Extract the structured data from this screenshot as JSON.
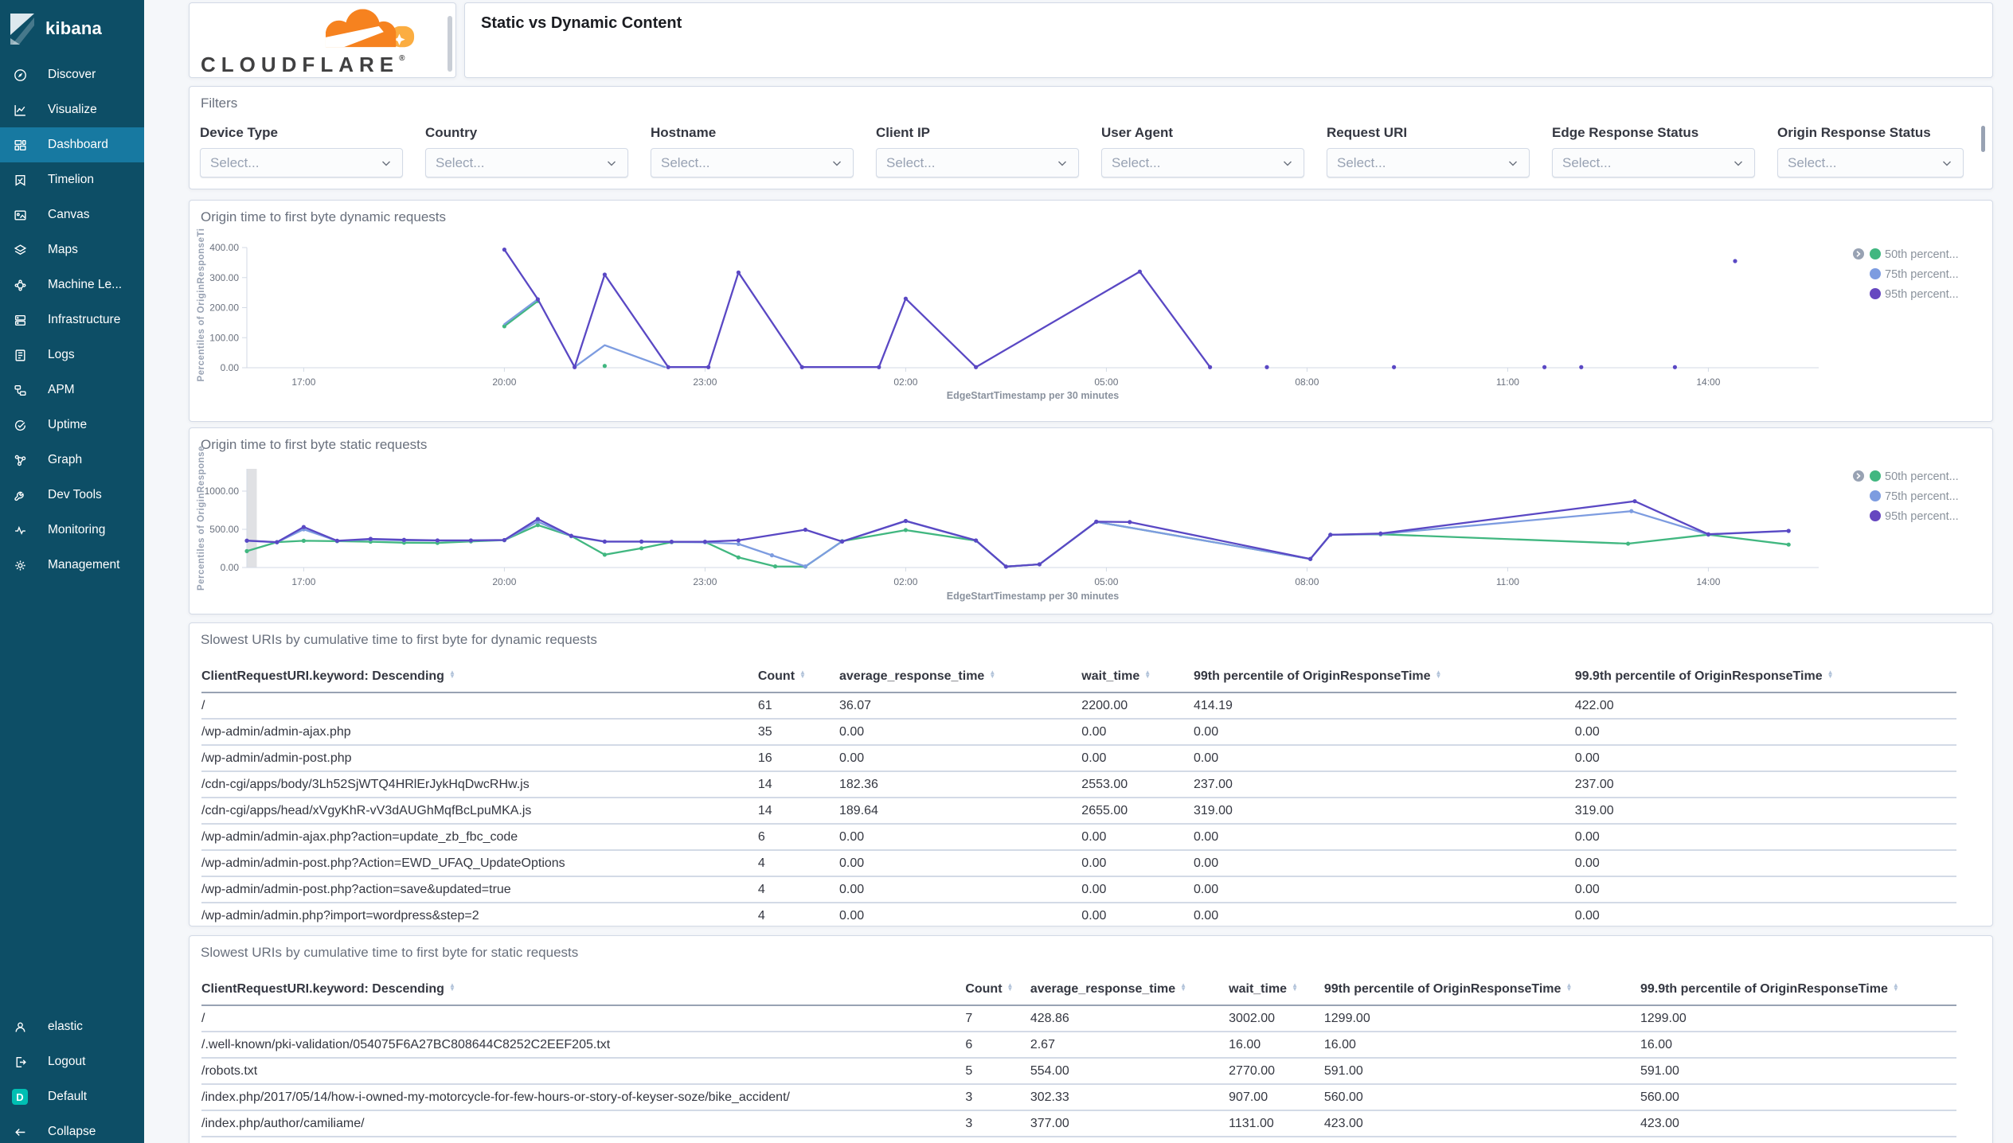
{
  "colors": {
    "sidebar_bg": "#0d4e66",
    "sidebar_selected": "#1779a1",
    "space_badge": "#00bfb3",
    "brand_orange": "#f6821f",
    "brand_orange_light": "#fbad41",
    "series_green": "#41b780",
    "series_blue": "#7d9ce0",
    "series_purple": "#5a48c4"
  },
  "sidebar": {
    "brand": "kibana",
    "items": [
      {
        "label": "Discover",
        "icon": "discover",
        "selected": false
      },
      {
        "label": "Visualize",
        "icon": "visualize",
        "selected": false
      },
      {
        "label": "Dashboard",
        "icon": "dashboard",
        "selected": true
      },
      {
        "label": "Timelion",
        "icon": "timelion",
        "selected": false
      },
      {
        "label": "Canvas",
        "icon": "canvas",
        "selected": false
      },
      {
        "label": "Maps",
        "icon": "maps",
        "selected": false
      },
      {
        "label": "Machine Le...",
        "icon": "machine-learning",
        "selected": false
      },
      {
        "label": "Infrastructure",
        "icon": "infrastructure",
        "selected": false
      },
      {
        "label": "Logs",
        "icon": "logs",
        "selected": false
      },
      {
        "label": "APM",
        "icon": "apm",
        "selected": false
      },
      {
        "label": "Uptime",
        "icon": "uptime",
        "selected": false
      },
      {
        "label": "Graph",
        "icon": "graph",
        "selected": false
      },
      {
        "label": "Dev Tools",
        "icon": "dev-tools",
        "selected": false
      },
      {
        "label": "Monitoring",
        "icon": "monitoring",
        "selected": false
      },
      {
        "label": "Management",
        "icon": "management",
        "selected": false
      }
    ],
    "bottom_items": [
      {
        "label": "elastic",
        "icon": "user"
      },
      {
        "label": "Logout",
        "icon": "logout"
      },
      {
        "label": "Default",
        "icon": "space-default",
        "badge": "D"
      },
      {
        "label": "Collapse",
        "icon": "collapse"
      }
    ]
  },
  "header": {
    "logo_text": "CLOUDFLARE",
    "logo_registered": "®",
    "title": "Static vs Dynamic Content"
  },
  "filters": {
    "panel_title": "Filters",
    "fields": [
      {
        "label": "Device Type",
        "placeholder": "Select..."
      },
      {
        "label": "Country",
        "placeholder": "Select..."
      },
      {
        "label": "Hostname",
        "placeholder": "Select..."
      },
      {
        "label": "Client IP",
        "placeholder": "Select..."
      },
      {
        "label": "User Agent",
        "placeholder": "Select..."
      },
      {
        "label": "Request URI",
        "placeholder": "Select..."
      },
      {
        "label": "Edge Response Status",
        "placeholder": "Select..."
      },
      {
        "label": "Origin Response Status",
        "placeholder": "Select..."
      }
    ]
  },
  "chart_data": [
    {
      "type": "line",
      "title": "Origin time to first byte dynamic requests",
      "xlabel": "EdgeStartTimestamp per 30 minutes",
      "ylabel": "Percentiles of OriginResponseTi",
      "ylim": [
        0,
        400
      ],
      "yticks": [
        {
          "v": 0,
          "label": "0.00"
        },
        {
          "v": 100,
          "label": "100.00"
        },
        {
          "v": 200,
          "label": "200.00"
        },
        {
          "v": 300,
          "label": "300.00"
        },
        {
          "v": 400,
          "label": "400.00"
        }
      ],
      "xticks": [
        {
          "t": 17,
          "label": "17:00"
        },
        {
          "t": 20,
          "label": "20:00"
        },
        {
          "t": 23,
          "label": "23:00"
        },
        {
          "t": 26,
          "label": "02:00"
        },
        {
          "t": 29,
          "label": "05:00"
        },
        {
          "t": 32,
          "label": "08:00"
        },
        {
          "t": 35,
          "label": "11:00"
        },
        {
          "t": 38,
          "label": "14:00"
        }
      ],
      "legend": [
        {
          "name": "50th percent...",
          "color": "#41b780"
        },
        {
          "name": "75th percent...",
          "color": "#7d9ce0"
        },
        {
          "name": "95th percent...",
          "color": "#6647c0"
        }
      ],
      "series": [
        {
          "name": "50th percent...",
          "color": "#41b780",
          "markers": true,
          "segments": [
            [
              [
                20,
                138
              ],
              [
                20.5,
                222
              ]
            ]
          ],
          "points": [
            [
              21.5,
              6
            ]
          ]
        },
        {
          "name": "75th percent...",
          "color": "#7d9ce0",
          "markers": false,
          "segments": [
            [
              [
                20,
                145
              ],
              [
                20.5,
                228
              ]
            ],
            [
              [
                21.05,
                2
              ],
              [
                21.5,
                75
              ],
              [
                22.4,
                2
              ]
            ]
          ],
          "points": []
        },
        {
          "name": "95th percent...",
          "color": "#5a48c4",
          "markers": true,
          "segments": [
            [
              [
                20,
                393
              ],
              [
                20.5,
                228
              ],
              [
                21.05,
                2
              ],
              [
                21.5,
                310
              ],
              [
                22.45,
                2
              ],
              [
                23.05,
                2
              ],
              [
                23.5,
                317
              ],
              [
                24.45,
                2
              ],
              [
                25.6,
                2
              ],
              [
                26,
                230
              ],
              [
                27.05,
                2
              ],
              [
                29.5,
                320
              ],
              [
                30.55,
                2
              ]
            ]
          ],
          "points": [
            [
              31.4,
              2
            ],
            [
              33.3,
              2
            ],
            [
              35.55,
              2
            ],
            [
              36.1,
              2
            ],
            [
              37.5,
              2
            ],
            [
              38.4,
              355
            ]
          ]
        }
      ],
      "band": null
    },
    {
      "type": "line",
      "title": "Origin time to first byte static requests",
      "xlabel": "EdgeStartTimestamp per 30 minutes",
      "ylabel": "Percentiles of OriginResponse",
      "ylim": [
        0,
        1300
      ],
      "yticks": [
        {
          "v": 0,
          "label": "0.00"
        },
        {
          "v": 500,
          "label": "500.00"
        },
        {
          "v": 1000,
          "label": "1000.00"
        }
      ],
      "xticks": [
        {
          "t": 17,
          "label": "17:00"
        },
        {
          "t": 20,
          "label": "20:00"
        },
        {
          "t": 23,
          "label": "23:00"
        },
        {
          "t": 26,
          "label": "02:00"
        },
        {
          "t": 29,
          "label": "05:00"
        },
        {
          "t": 32,
          "label": "08:00"
        },
        {
          "t": 35,
          "label": "11:00"
        },
        {
          "t": 38,
          "label": "14:00"
        }
      ],
      "legend": [
        {
          "name": "50th percent...",
          "color": "#41b780"
        },
        {
          "name": "75th percent...",
          "color": "#7d9ce0"
        },
        {
          "name": "95th percent...",
          "color": "#6647c0"
        }
      ],
      "series": [
        {
          "name": "50th percent...",
          "color": "#41b780",
          "markers": true,
          "segments": [
            [
              [
                16.15,
                215
              ],
              [
                16.6,
                332
              ],
              [
                17,
                350
              ],
              [
                17.5,
                345
              ],
              [
                18,
                338
              ],
              [
                18.5,
                325
              ],
              [
                19,
                322
              ],
              [
                19.5,
                342
              ],
              [
                20,
                358
              ],
              [
                20.5,
                555
              ],
              [
                21,
                412
              ],
              [
                21.5,
                168
              ],
              [
                22.05,
                252
              ],
              [
                22.5,
                332
              ],
              [
                23,
                335
              ],
              [
                23.5,
                132
              ],
              [
                24.05,
                15
              ],
              [
                24.5,
                12
              ],
              [
                25.05,
                345
              ],
              [
                26,
                490
              ],
              [
                27.05,
                352
              ],
              [
                27.5,
                12
              ],
              [
                28,
                42
              ],
              [
                28.85,
                598
              ],
              [
                32.05,
                112
              ],
              [
                32.35,
                428
              ],
              [
                33.1,
                435
              ],
              [
                36.8,
                312
              ],
              [
                38,
                430
              ],
              [
                39.2,
                300
              ]
            ]
          ],
          "points": []
        },
        {
          "name": "75th percent...",
          "color": "#7d9ce0",
          "markers": true,
          "segments": [
            [
              [
                16.15,
                350
              ],
              [
                16.6,
                330
              ],
              [
                17,
                500
              ],
              [
                17.5,
                348
              ],
              [
                18,
                368
              ],
              [
                18.5,
                355
              ],
              [
                19,
                352
              ],
              [
                19.5,
                352
              ],
              [
                20,
                358
              ],
              [
                20.5,
                600
              ],
              [
                21,
                410
              ],
              [
                21.5,
                338
              ],
              [
                22.05,
                338
              ],
              [
                22.5,
                335
              ],
              [
                23,
                330
              ],
              [
                23.5,
                308
              ],
              [
                24,
                160
              ],
              [
                24.5,
                15
              ],
              [
                25.05,
                342
              ],
              [
                26,
                608
              ],
              [
                27.05,
                352
              ],
              [
                27.5,
                12
              ],
              [
                28,
                42
              ],
              [
                28.85,
                598
              ],
              [
                32.05,
                112
              ],
              [
                32.35,
                428
              ],
              [
                33.1,
                440
              ],
              [
                36.85,
                738
              ],
              [
                38,
                432
              ],
              [
                39.2,
                478
              ]
            ]
          ],
          "points": []
        },
        {
          "name": "95th percent...",
          "color": "#5a48c4",
          "markers": true,
          "segments": [
            [
              [
                16.15,
                352
              ],
              [
                16.6,
                332
              ],
              [
                17,
                530
              ],
              [
                17.5,
                350
              ],
              [
                18,
                375
              ],
              [
                18.5,
                362
              ],
              [
                19,
                355
              ],
              [
                19.5,
                355
              ],
              [
                20,
                360
              ],
              [
                20.5,
                635
              ],
              [
                21,
                415
              ],
              [
                21.5,
                340
              ],
              [
                22.05,
                340
              ],
              [
                22.5,
                338
              ],
              [
                23,
                338
              ],
              [
                23.5,
                355
              ],
              [
                24.5,
                495
              ],
              [
                25.05,
                340
              ],
              [
                26,
                610
              ],
              [
                27.05,
                355
              ],
              [
                27.5,
                12
              ],
              [
                28,
                42
              ],
              [
                28.85,
                600
              ],
              [
                29.35,
                595
              ],
              [
                32.05,
                112
              ],
              [
                32.35,
                428
              ],
              [
                33.1,
                445
              ],
              [
                36.9,
                868
              ],
              [
                38,
                435
              ],
              [
                39.2,
                480
              ]
            ]
          ],
          "points": []
        }
      ],
      "band": {
        "t": 16.15,
        "w": 13
      }
    }
  ],
  "tables": [
    {
      "title": "Slowest URIs by cumulative time to first byte for dynamic requests",
      "headers": [
        "ClientRequestURI.keyword: Descending",
        "Count",
        "average_response_time",
        "wait_time",
        "99th percentile of OriginResponseTime",
        "99.9th percentile of OriginResponseTime"
      ],
      "rows": [
        [
          "/",
          "61",
          "36.07",
          "2200.00",
          "414.19",
          "422.00"
        ],
        [
          "/wp-admin/admin-ajax.php",
          "35",
          "0.00",
          "0.00",
          "0.00",
          "0.00"
        ],
        [
          "/wp-admin/admin-post.php",
          "16",
          "0.00",
          "0.00",
          "0.00",
          "0.00"
        ],
        [
          "/cdn-cgi/apps/body/3Lh52SjWTQ4HRlErJykHqDwcRHw.js",
          "14",
          "182.36",
          "2553.00",
          "237.00",
          "237.00"
        ],
        [
          "/cdn-cgi/apps/head/xVgyKhR-vV3dAUGhMqfBcLpuMKA.js",
          "14",
          "189.64",
          "2655.00",
          "319.00",
          "319.00"
        ],
        [
          "/wp-admin/admin-ajax.php?action=update_zb_fbc_code",
          "6",
          "0.00",
          "0.00",
          "0.00",
          "0.00"
        ],
        [
          "/wp-admin/admin-post.php?Action=EWD_UFAQ_UpdateOptions",
          "4",
          "0.00",
          "0.00",
          "0.00",
          "0.00"
        ],
        [
          "/wp-admin/admin-post.php?action=save&updated=true",
          "4",
          "0.00",
          "0.00",
          "0.00",
          "0.00"
        ],
        [
          "/wp-admin/admin.php?import=wordpress&step=2",
          "4",
          "0.00",
          "0.00",
          "0.00",
          "0.00"
        ]
      ]
    },
    {
      "title": "Slowest URIs by cumulative time to first byte for static requests",
      "headers": [
        "ClientRequestURI.keyword: Descending",
        "Count",
        "average_response_time",
        "wait_time",
        "99th percentile of OriginResponseTime",
        "99.9th percentile of OriginResponseTime"
      ],
      "rows": [
        [
          "/",
          "7",
          "428.86",
          "3002.00",
          "1299.00",
          "1299.00"
        ],
        [
          "/.well-known/pki-validation/054075F6A27BC808644C8252C2EEF205.txt",
          "6",
          "2.67",
          "16.00",
          "16.00",
          "16.00"
        ],
        [
          "/robots.txt",
          "5",
          "554.00",
          "2770.00",
          "591.00",
          "591.00"
        ],
        [
          "/index.php/2017/05/14/how-i-owned-my-motorcycle-for-few-hours-or-story-of-keyser-soze/bike_accident/",
          "3",
          "302.33",
          "907.00",
          "560.00",
          "560.00"
        ],
        [
          "/index.php/author/camiliame/",
          "3",
          "377.00",
          "1131.00",
          "423.00",
          "423.00"
        ]
      ]
    }
  ]
}
